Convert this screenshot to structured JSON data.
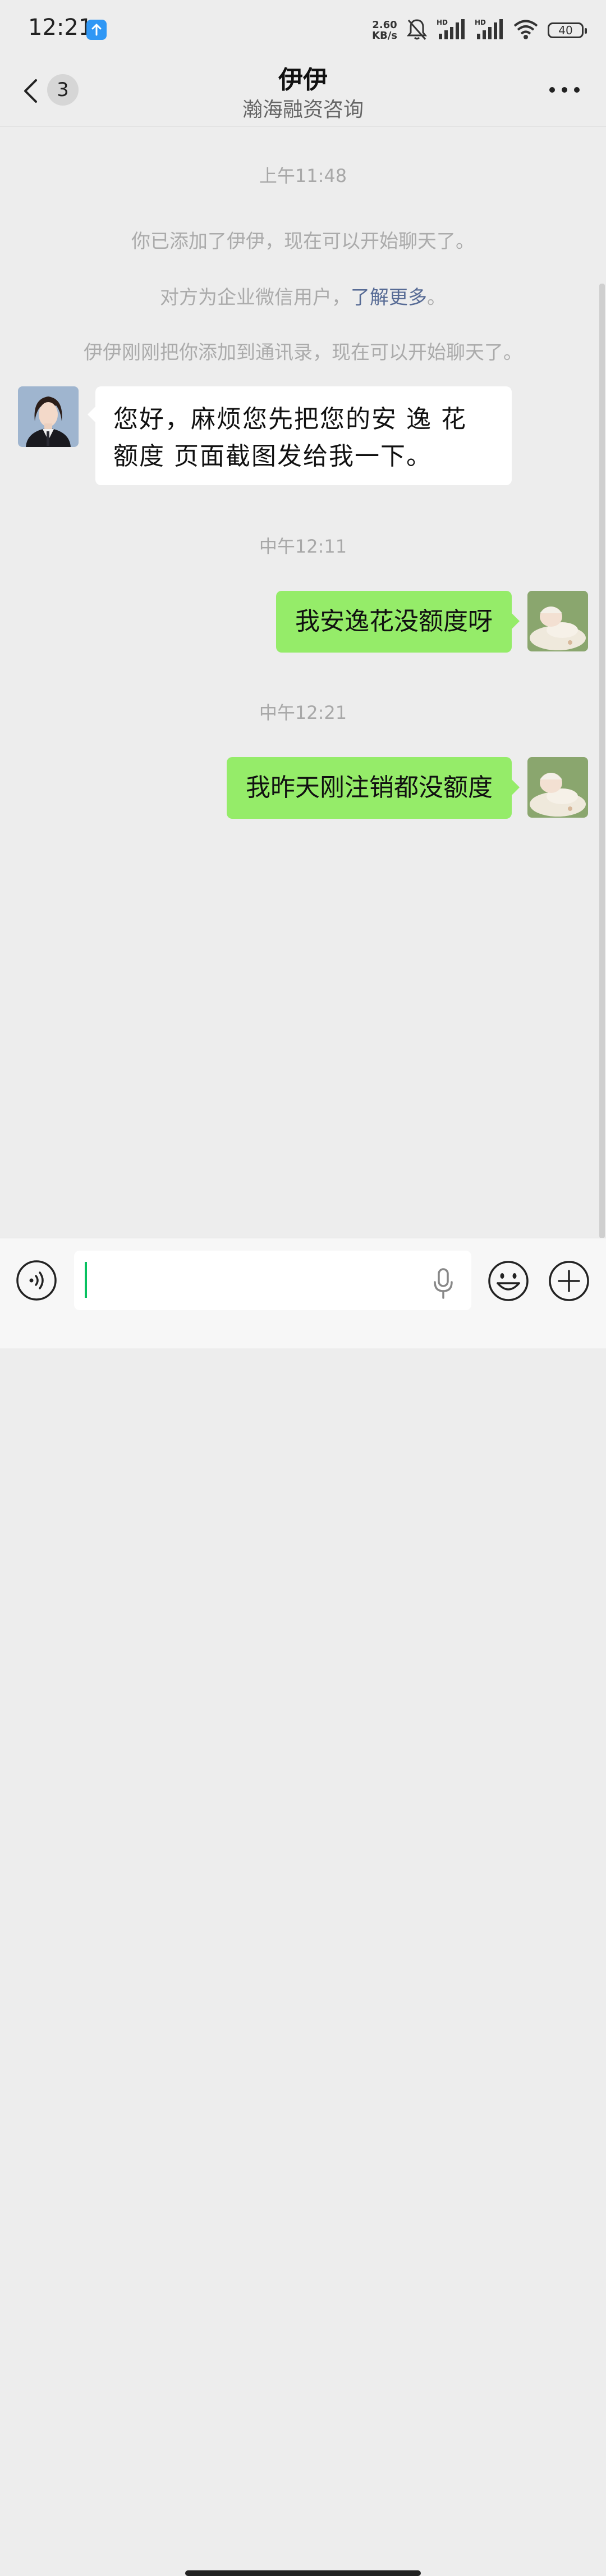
{
  "status_bar": {
    "time": "12:21",
    "network_speed_value": "2.60",
    "network_speed_unit": "KB/s",
    "battery_level": "40",
    "upload_icon": "arrow-up-icon",
    "icons": [
      "bell-muted-icon",
      "signal-hd-icon",
      "signal-hd-icon",
      "wifi-icon",
      "battery-icon"
    ]
  },
  "header": {
    "back_icon": "chevron-left-icon",
    "unread_count": "3",
    "title": "伊伊",
    "subtitle": "瀚海融资咨询",
    "more_icon": "more-dots-icon"
  },
  "messages": {
    "time_1": "上午11:48",
    "system_1": "你已添加了伊伊，现在可以开始聊天了。",
    "system_2_text": "对方为企业微信用户，",
    "system_2_link": "了解更多",
    "system_2_end": "。",
    "system_3": "伊伊刚刚把你添加到通讯录，现在可以开始聊天了。",
    "incoming_1": "您好，麻烦您先把您的安 逸 花 额度 页面截图发给我一下。",
    "time_2": "中午12:11",
    "outgoing_1": "我安逸花没额度呀",
    "time_3": "中午12:21",
    "outgoing_2": "我昨天刚注销都没额度"
  },
  "input_bar": {
    "message_value": "",
    "voice_icon": "voice-wave-icon",
    "mic_icon": "microphone-icon",
    "emoji_icon": "emoji-smile-icon",
    "plus_icon": "plus-circle-icon"
  },
  "colors": {
    "background": "#ededed",
    "outgoing_bubble": "#95ec69",
    "incoming_bubble": "#ffffff",
    "link": "#576b95",
    "caret": "#07c160",
    "upload_badge": "#2f97f5"
  }
}
